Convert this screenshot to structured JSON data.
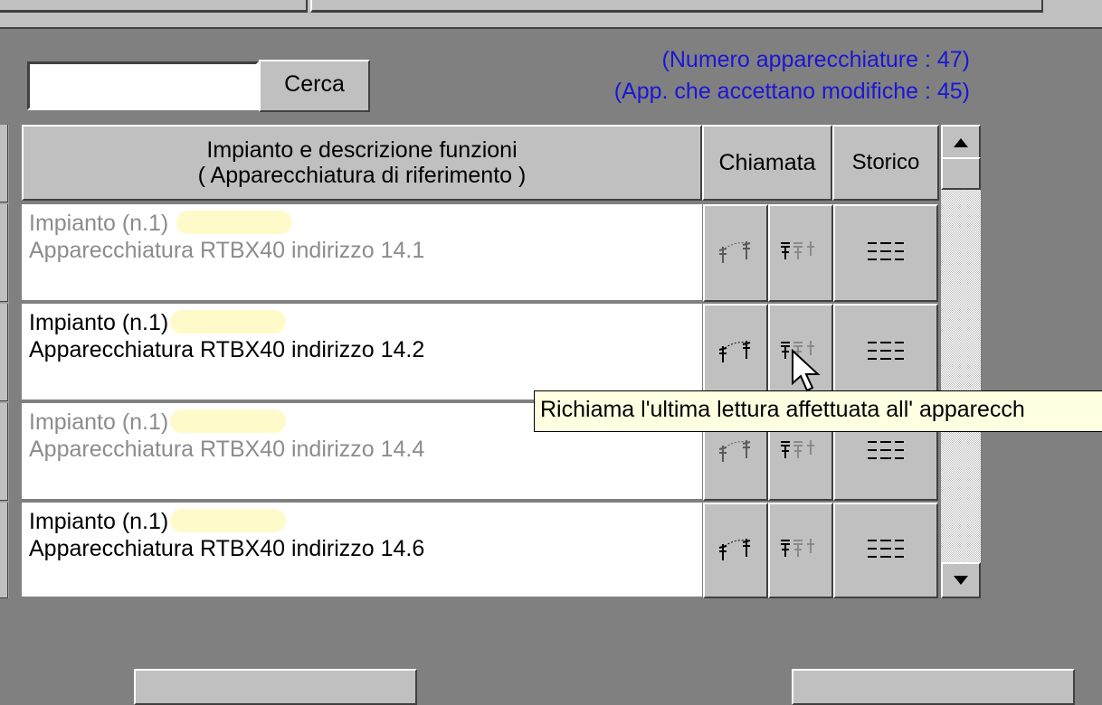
{
  "search": {
    "value": "",
    "button_label": "Cerca"
  },
  "stats": {
    "count_text": "(Numero apparecchiature : 47)",
    "modify_text": "(App. che accettano modifiche : 45)"
  },
  "table": {
    "header_desc_line1": "Impianto e descrizione funzioni",
    "header_desc_line2": "( Apparecchiatura di riferimento )",
    "header_call": "Chiamata",
    "header_history": "Storico",
    "rows": [
      {
        "plant": "Impianto (n.1) ",
        "device": "Apparecchiatura RTBX40 indirizzo 14.1",
        "enabled": false
      },
      {
        "plant": "Impianto (n.1)",
        "device": "Apparecchiatura RTBX40 indirizzo 14.2",
        "enabled": true
      },
      {
        "plant": "Impianto (n.1)",
        "device": "Apparecchiatura RTBX40 indirizzo 14.4",
        "enabled": false
      },
      {
        "plant": "Impianto (n.1)",
        "device": "Apparecchiatura RTBX40 indirizzo 14.6",
        "enabled": true
      }
    ]
  },
  "tooltip": {
    "text": "Richiama l'ultima lettura affettuata all' apparecch"
  },
  "icons": {
    "call": "antenna-call-icon",
    "last_reading": "multi-antenna-icon",
    "history": "list-lines-icon",
    "cursor": "mouse-pointer-icon"
  },
  "colors": {
    "stats_text": "#1a16d6",
    "tooltip_bg": "#ffffe1",
    "highlight": "#fffaca",
    "dim_text": "#8c8c8c"
  }
}
